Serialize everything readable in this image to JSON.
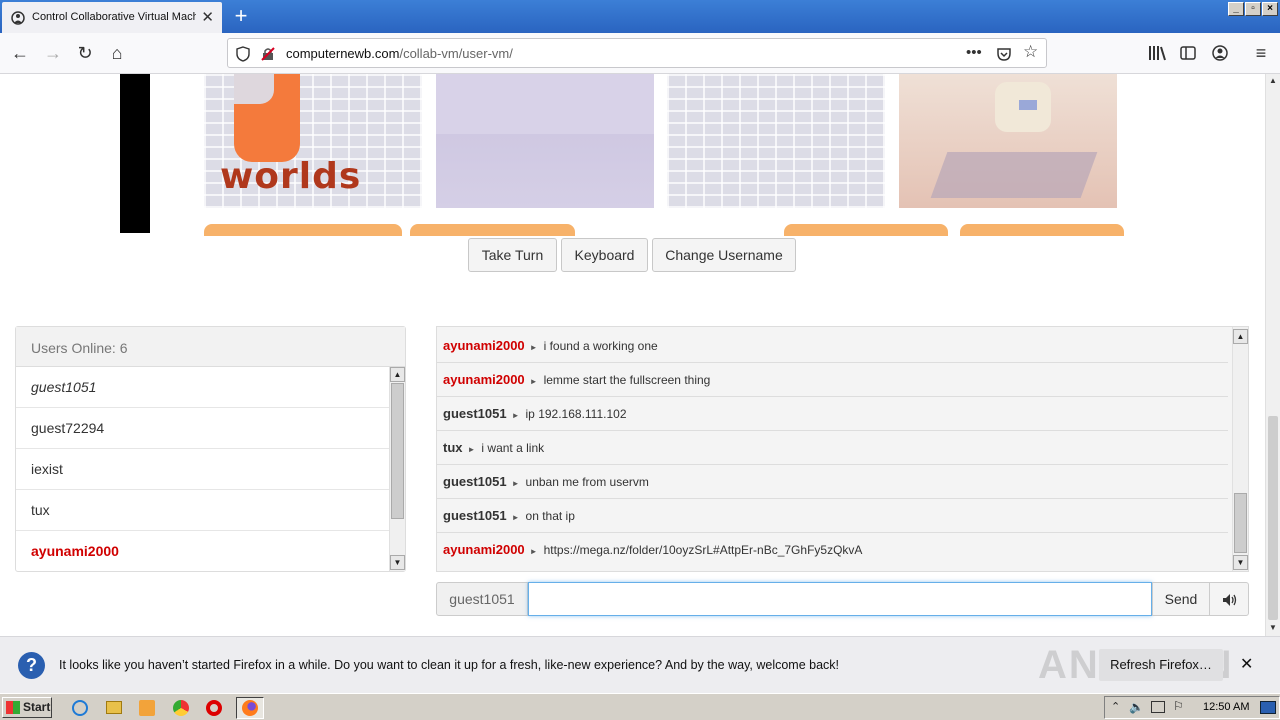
{
  "browser": {
    "tab_title": "Control Collaborative Virtual Machine",
    "url_domain": "computernewb.com",
    "url_path": "/collab-vm/user-vm/"
  },
  "vm_thumbs": {
    "logo_text": "worlds"
  },
  "controls": {
    "take_turn": "Take Turn",
    "keyboard": "Keyboard",
    "change_username": "Change Username"
  },
  "users": {
    "header": "Users Online: 6",
    "list": [
      {
        "name": "guest1051"
      },
      {
        "name": "guest72294"
      },
      {
        "name": "iexist"
      },
      {
        "name": "tux"
      },
      {
        "name": "ayunami2000"
      }
    ]
  },
  "chat": {
    "messages": [
      {
        "user": "ayunami2000",
        "text": "i found a working one"
      },
      {
        "user": "ayunami2000",
        "text": "lemme start the fullscreen thing"
      },
      {
        "user": "guest1051",
        "text": "ip 192.168.111.102"
      },
      {
        "user": "tux",
        "text": "i want a link"
      },
      {
        "user": "guest1051",
        "text": "unban me from uservm"
      },
      {
        "user": "guest1051",
        "text": "on that ip"
      },
      {
        "user": "ayunami2000",
        "text": "https://mega.nz/folder/10oyzSrL#AttpEr-nBc_7GhFy5zQkvA"
      }
    ],
    "username_label": "guest1051",
    "input_value": "",
    "send_label": "Send"
  },
  "notification": {
    "text": "It looks like you haven’t started Firefox in a while. Do you want to clean it up for a fresh, like-new experience? And by the way, welcome back!",
    "button": "Refresh Firefox…",
    "watermark": "ANY RUN"
  },
  "taskbar": {
    "start": "Start",
    "clock": "12:50 AM"
  },
  "colors": {
    "admin_red": "#d00000",
    "accent_orange": "#f7b26a"
  }
}
